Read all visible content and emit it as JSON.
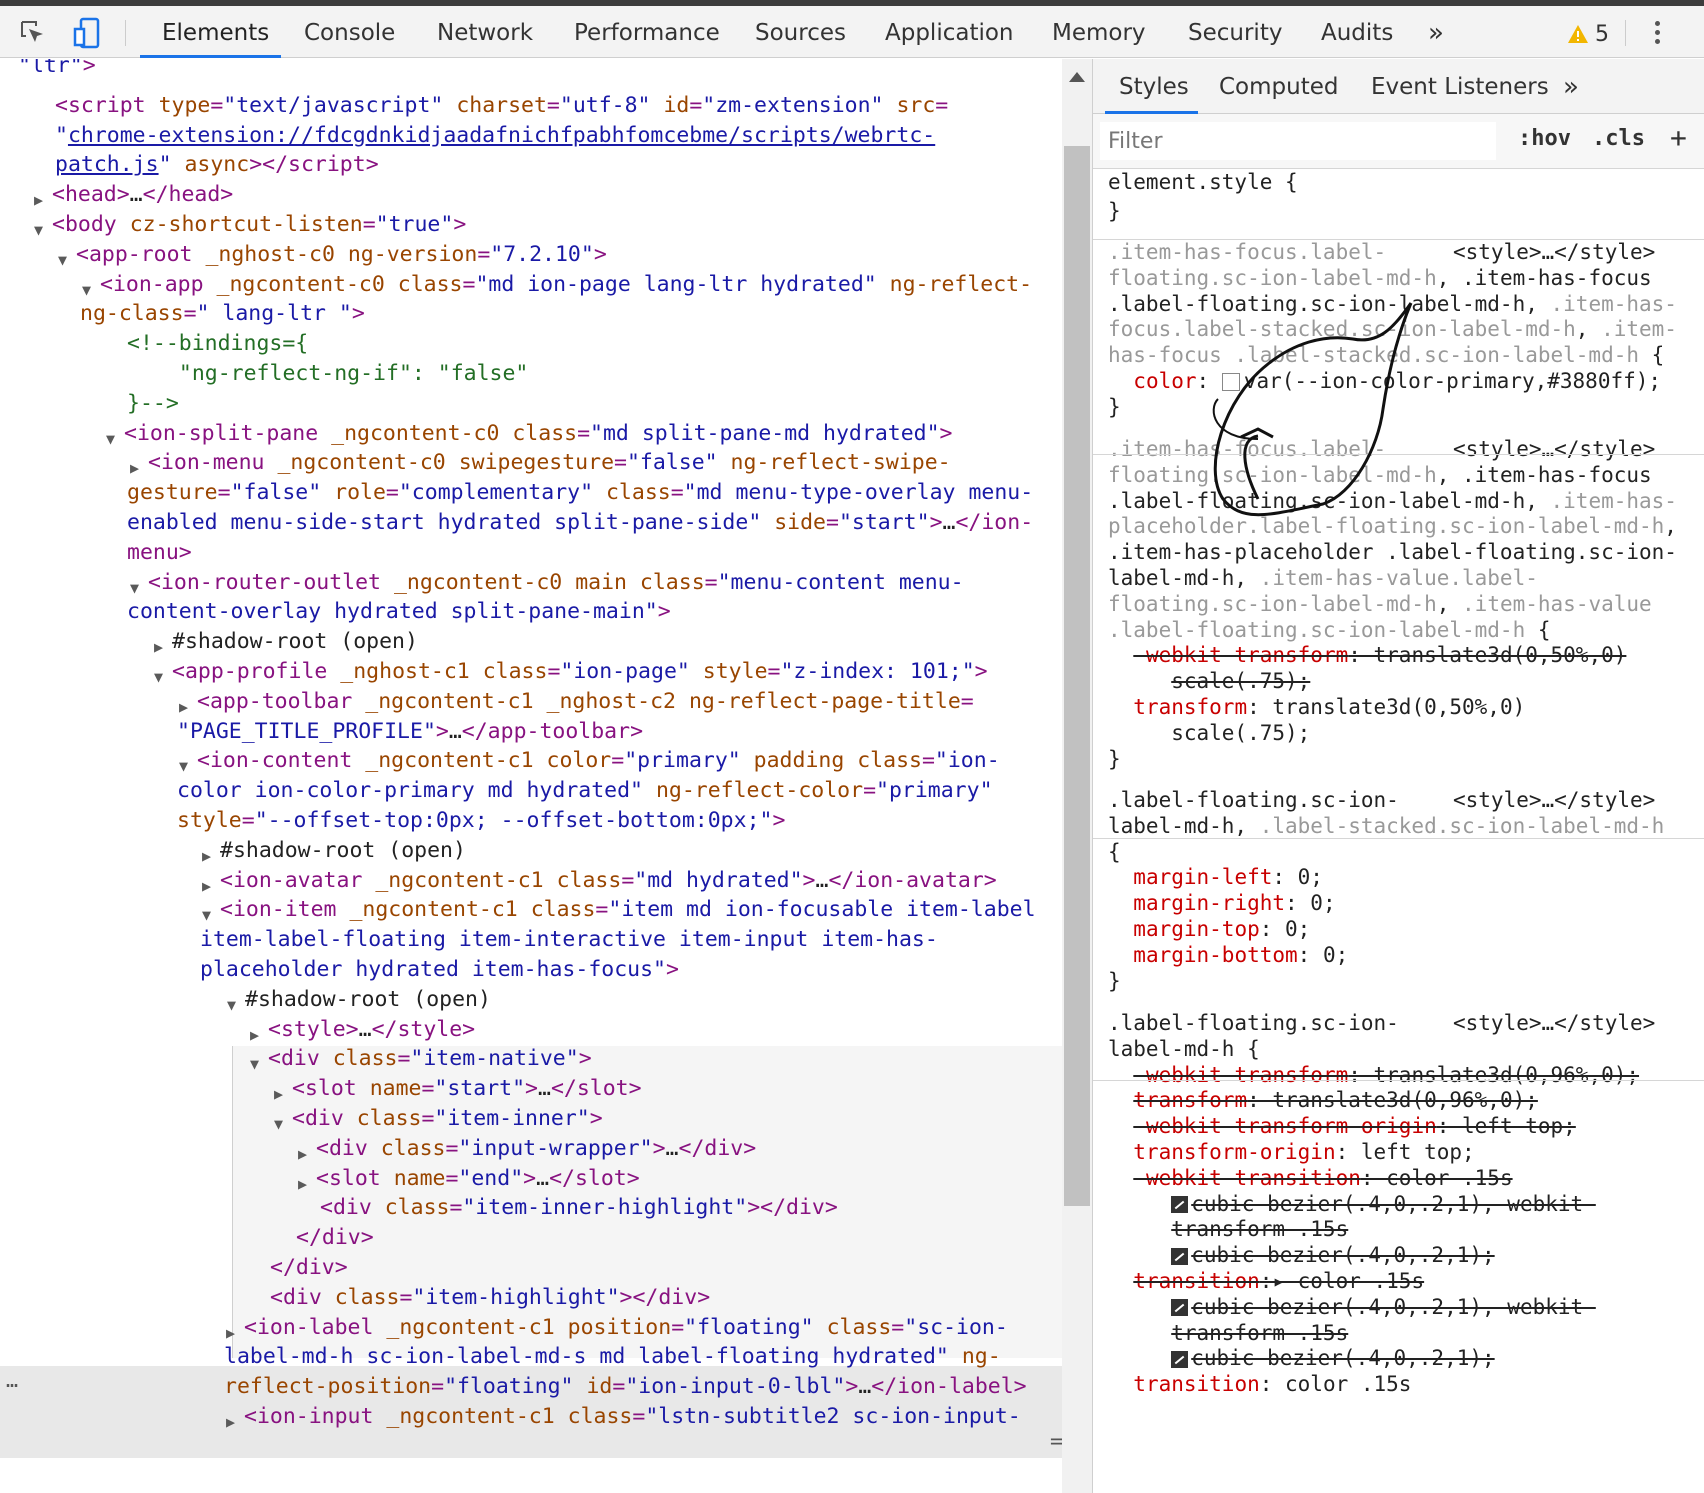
{
  "toolbar": {
    "tabs": [
      "Elements",
      "Console",
      "Network",
      "Performance",
      "Sources",
      "Application",
      "Memory",
      "Security",
      "Audits"
    ],
    "more": "»",
    "warnings_count": "5",
    "icons": [
      "inspect-icon",
      "device-toolbar-icon",
      "warning-icon",
      "kebab-menu-icon"
    ]
  },
  "dom": {
    "lines": [
      {
        "html": "<span class=\"av\">\"ltr\"</span><span class=\"tg\">&gt;</span>"
      },
      {
        "html": "<span class=\"tg\">&lt;script</span> <span class=\"an\">type</span><span class=\"tg\">=</span><span class=\"av\">\"text/javascript\"</span> <span class=\"an\">charset</span><span class=\"tg\">=</span><span class=\"av\">\"utf-8\"</span> <span class=\"an\">id</span><span class=\"tg\">=</span><span class=\"av\">\"zm-extension\"</span> <span class=\"an\">src</span><span class=\"tg\">=</span>"
      },
      {
        "html": "<span class=\"av\">\"</span><span class=\"lk\">chrome-extension://fdcgdnkidjaadafnichfpabhfomcebme/scripts/webrtc-</span>"
      },
      {
        "html": "<span class=\"lk\">patch.js</span><span class=\"av\">\"</span> <span class=\"an\">async</span><span class=\"tg\">&gt;&lt;/script&gt;</span>"
      },
      {
        "html": "<span class=\"tg\">&lt;head&gt;</span>…<span class=\"tg\">&lt;/head&gt;</span>"
      },
      {
        "html": "<span class=\"tg\">&lt;body</span> <span class=\"an\">cz-shortcut-listen</span><span class=\"tg\">=</span><span class=\"av\">\"true\"</span><span class=\"tg\">&gt;</span>"
      },
      {
        "html": "<span class=\"tg\">&lt;app-root</span> <span class=\"an\">_nghost-c0</span> <span class=\"an\">ng-version</span><span class=\"tg\">=</span><span class=\"av\">\"7.2.10\"</span><span class=\"tg\">&gt;</span>"
      },
      {
        "html": "<span class=\"tg\">&lt;ion-app</span> <span class=\"an\">_ngcontent-c0</span> <span class=\"an\">class</span><span class=\"tg\">=</span><span class=\"av\">\"md ion-page lang-ltr hydrated\"</span> <span class=\"an\">ng-reflect-</span>"
      },
      {
        "html": "<span class=\"an\">ng-class</span><span class=\"tg\">=</span><span class=\"av\">\" lang-ltr \"</span><span class=\"tg\">&gt;</span>"
      },
      {
        "html": "<span class=\"cm\">&lt;!--bindings={</span>"
      },
      {
        "html": "<span class=\"cm\">  \"ng-reflect-ng-if\": \"false\"</span>"
      },
      {
        "html": "<span class=\"cm\">}--&gt;</span>"
      },
      {
        "html": "<span class=\"tg\">&lt;ion-split-pane</span> <span class=\"an\">_ngcontent-c0</span> <span class=\"an\">class</span><span class=\"tg\">=</span><span class=\"av\">\"md split-pane-md hydrated\"</span><span class=\"tg\">&gt;</span>"
      },
      {
        "html": "<span class=\"tg\">&lt;ion-menu</span> <span class=\"an\">_ngcontent-c0</span> <span class=\"an\">swipegesture</span><span class=\"tg\">=</span><span class=\"av\">\"false\"</span> <span class=\"an\">ng-reflect-swipe-</span>"
      },
      {
        "html": "<span class=\"an\">gesture</span><span class=\"tg\">=</span><span class=\"av\">\"false\"</span> <span class=\"an\">role</span><span class=\"tg\">=</span><span class=\"av\">\"complementary\"</span> <span class=\"an\">class</span><span class=\"tg\">=</span><span class=\"av\">\"md menu-type-overlay menu-</span>"
      },
      {
        "html": "<span class=\"av\">enabled menu-side-start hydrated split-pane-side\"</span> <span class=\"an\">side</span><span class=\"tg\">=</span><span class=\"av\">\"start\"</span><span class=\"tg\">&gt;</span>…<span class=\"tg\">&lt;/ion-</span>"
      },
      {
        "html": "<span class=\"tg\">menu&gt;</span>"
      },
      {
        "html": "<span class=\"tg\">&lt;ion-router-outlet</span> <span class=\"an\">_ngcontent-c0</span> <span class=\"an\">main</span> <span class=\"an\">class</span><span class=\"tg\">=</span><span class=\"av\">\"menu-content menu-</span>"
      },
      {
        "html": "<span class=\"av\">content-overlay hydrated split-pane-main\"</span><span class=\"tg\">&gt;</span>"
      },
      {
        "html": "#shadow-root (open)"
      },
      {
        "html": "<span class=\"tg\">&lt;app-profile</span> <span class=\"an\">_nghost-c1</span> <span class=\"an\">class</span><span class=\"tg\">=</span><span class=\"av\">\"ion-page\"</span> <span class=\"an\">style</span><span class=\"tg\">=</span><span class=\"av\">\"z-index: 101;\"</span><span class=\"tg\">&gt;</span>"
      },
      {
        "html": "<span class=\"tg\">&lt;app-toolbar</span> <span class=\"an\">_ngcontent-c1</span> <span class=\"an\">_nghost-c2</span> <span class=\"an\">ng-reflect-page-title</span><span class=\"tg\">=</span>"
      },
      {
        "html": "<span class=\"av\">\"PAGE_TITLE_PROFILE\"</span><span class=\"tg\">&gt;</span>…<span class=\"tg\">&lt;/app-toolbar&gt;</span>"
      },
      {
        "html": "<span class=\"tg\">&lt;ion-content</span> <span class=\"an\">_ngcontent-c1</span> <span class=\"an\">color</span><span class=\"tg\">=</span><span class=\"av\">\"primary\"</span> <span class=\"an\">padding</span> <span class=\"an\">class</span><span class=\"tg\">=</span><span class=\"av\">\"ion-</span>"
      },
      {
        "html": "<span class=\"av\">color ion-color-primary md hydrated\"</span> <span class=\"an\">ng-reflect-color</span><span class=\"tg\">=</span><span class=\"av\">\"primary\"</span>"
      },
      {
        "html": "<span class=\"an\">style</span><span class=\"tg\">=</span><span class=\"av\">\"--offset-top:0px; --offset-bottom:0px;\"</span><span class=\"tg\">&gt;</span>"
      },
      {
        "html": "#shadow-root (open)"
      },
      {
        "html": "<span class=\"tg\">&lt;ion-avatar</span> <span class=\"an\">_ngcontent-c1</span> <span class=\"an\">class</span><span class=\"tg\">=</span><span class=\"av\">\"md hydrated\"</span><span class=\"tg\">&gt;</span>…<span class=\"tg\">&lt;/ion-avatar&gt;</span>"
      },
      {
        "html": "<span class=\"tg\">&lt;ion-item</span> <span class=\"an\">_ngcontent-c1</span> <span class=\"an\">class</span><span class=\"tg\">=</span><span class=\"av\">\"item md ion-focusable item-label</span>"
      },
      {
        "html": "<span class=\"av\">item-label-floating item-interactive item-input item-has-</span>"
      },
      {
        "html": "<span class=\"av\">placeholder hydrated item-has-focus\"</span><span class=\"tg\">&gt;</span>"
      },
      {
        "html": "#shadow-root (open)"
      },
      {
        "html": "<span class=\"tg\">&lt;style&gt;</span>…<span class=\"tg\">&lt;/style&gt;</span>"
      },
      {
        "html": "<span class=\"tg\">&lt;div</span> <span class=\"an\">class</span><span class=\"tg\">=</span><span class=\"av\">\"item-native\"</span><span class=\"tg\">&gt;</span>"
      },
      {
        "html": "<span class=\"tg\">&lt;slot</span> <span class=\"an\">name</span><span class=\"tg\">=</span><span class=\"av\">\"start\"</span><span class=\"tg\">&gt;</span>…<span class=\"tg\">&lt;/slot&gt;</span>"
      },
      {
        "html": "<span class=\"tg\">&lt;div</span> <span class=\"an\">class</span><span class=\"tg\">=</span><span class=\"av\">\"item-inner\"</span><span class=\"tg\">&gt;</span>"
      },
      {
        "html": "<span class=\"tg\">&lt;div</span> <span class=\"an\">class</span><span class=\"tg\">=</span><span class=\"av\">\"input-wrapper\"</span><span class=\"tg\">&gt;</span>…<span class=\"tg\">&lt;/div&gt;</span>"
      },
      {
        "html": "<span class=\"tg\">&lt;slot</span> <span class=\"an\">name</span><span class=\"tg\">=</span><span class=\"av\">\"end\"</span><span class=\"tg\">&gt;</span>…<span class=\"tg\">&lt;/slot&gt;</span>"
      },
      {
        "html": "<span class=\"tg\">&lt;div</span> <span class=\"an\">class</span><span class=\"tg\">=</span><span class=\"av\">\"item-inner-highlight\"</span><span class=\"tg\">&gt;&lt;/div&gt;</span>"
      },
      {
        "html": "<span class=\"tg\">&lt;/div&gt;</span>"
      },
      {
        "html": "<span class=\"tg\">&lt;/div&gt;</span>"
      },
      {
        "html": "<span class=\"tg\">&lt;div</span> <span class=\"an\">class</span><span class=\"tg\">=</span><span class=\"av\">\"item-highlight\"</span><span class=\"tg\">&gt;&lt;/div&gt;</span>"
      },
      {
        "html": "<span class=\"tg\">&lt;ion-label</span> <span class=\"an\">_ngcontent-c1</span> <span class=\"an\">position</span><span class=\"tg\">=</span><span class=\"av\">\"floating\"</span> <span class=\"an\">class</span><span class=\"tg\">=</span><span class=\"av\">\"sc-ion-</span>"
      },
      {
        "html": "<span class=\"av\">label-md-h sc-ion-label-md-s md label-floating hydrated\"</span> <span class=\"an\">ng-</span>"
      },
      {
        "html": "<span class=\"an\">reflect-position</span><span class=\"tg\">=</span><span class=\"av\">\"floating\"</span> <span class=\"an\">id</span><span class=\"tg\">=</span><span class=\"av\">\"ion-input-0-lbl\"</span><span class=\"tg\">&gt;</span>…<span class=\"tg\">&lt;/ion-label&gt;</span>"
      },
      {
        "html": "<span class=\"tg\">&lt;ion-input</span> <span class=\"an\">_ngcontent-c1</span> <span class=\"an\">class</span><span class=\"tg\">=</span><span class=\"av\">\"lstn-subtitle2 sc-ion-input-</span>"
      }
    ],
    "selected_marker": "…",
    "eq_marker": "=",
    "triangle_expanded": "▼",
    "triangle_collapsed": "▶"
  },
  "styles_pane": {
    "tabs": [
      "Styles",
      "Computed",
      "Event Listeners"
    ],
    "more": "»",
    "filter_placeholder": "Filter",
    "hov": ":hov",
    "cls": ".cls",
    "plus": "+",
    "src_label": "<style>…</style>",
    "lines": [
      {
        "html": "element.style {"
      },
      {
        "html": "}"
      },
      {
        "html": "<span class=\"dim\">.item-has-focus.label-</span>"
      },
      {
        "html": "<span class=\"dim\">floating.sc-ion-label-md-h</span>, .item-has-focus"
      },
      {
        "html": ".label-floating.sc-ion-label-md-h, <span class=\"dim\">.item-has-</span>"
      },
      {
        "html": "<span class=\"dim\">focus.label-stacked.sc-ion-label-md-h</span>, <span class=\"dim\">.item-</span>"
      },
      {
        "html": "<span class=\"dim\">has-focus .label-stacked.sc-ion-label-md-h</span> {"
      },
      {
        "html": "  <span class=\"pn\">color</span>: <span class=\"swatch\"></span>var(--ion-color-primary,#3880ff);"
      },
      {
        "html": "}"
      },
      {
        "html": "<span class=\"dim\">.item-has-focus.label-</span>"
      },
      {
        "html": "<span class=\"dim\">floating.sc-ion-label-md-h</span>, .item-has-focus"
      },
      {
        "html": ".label-floating.sc-ion-label-md-h, <span class=\"dim\">.item-has-</span>"
      },
      {
        "html": "<span class=\"dim\">placeholder.label-floating.sc-ion-label-md-h</span>,"
      },
      {
        "html": ".item-has-placeholder .label-floating.sc-ion-"
      },
      {
        "html": "label-md-h, <span class=\"dim\">.item-has-value.label-</span>"
      },
      {
        "html": "<span class=\"dim\">floating.sc-ion-label-md-h</span>, <span class=\"dim\">.item-has-value</span>"
      },
      {
        "html": "<span class=\"dim\">.label-floating.sc-ion-label-md-h</span> {"
      },
      {
        "html": "  <span class=\"strike\"><span class=\"pn\">-webkit-transform</span>: translate3d(0,50%,0)</span>"
      },
      {
        "html": "     <span class=\"strike\">scale(.75);</span>"
      },
      {
        "html": "  <span class=\"pn\">transform</span>: translate3d(0,50%,0)"
      },
      {
        "html": "     scale(.75);"
      },
      {
        "html": "}"
      },
      {
        "html": ".label-floating.sc-ion-"
      },
      {
        "html": "label-md-h, <span class=\"dim\">.label-stacked.sc-ion-label-md-h</span>"
      },
      {
        "html": "{"
      },
      {
        "html": "  <span class=\"pn\">margin-left</span>: 0;"
      },
      {
        "html": "  <span class=\"pn\">margin-right</span>: 0;"
      },
      {
        "html": "  <span class=\"pn\">margin-top</span>: 0;"
      },
      {
        "html": "  <span class=\"pn\">margin-bottom</span>: 0;"
      },
      {
        "html": "}"
      },
      {
        "html": ".label-floating.sc-ion-"
      },
      {
        "html": "label-md-h {"
      },
      {
        "html": "  <span class=\"strike\"><span class=\"pn\">-webkit-transform</span>: translate3d(0,96%,0);</span>"
      },
      {
        "html": "  <span class=\"strike\"><span class=\"pn\">transform</span>: translate3d(0,96%,0);</span>"
      },
      {
        "html": "  <span class=\"strike\"><span class=\"pn\">-webkit-transform-origin</span>: left top;</span>"
      },
      {
        "html": "  <span class=\"pn\">transform-origin</span>: left top;"
      },
      {
        "html": "  <span class=\"strike\"><span class=\"pn\">-webkit-transition</span>: color .15s</span>"
      },
      {
        "html": "     <span class=\"bez\"></span><span class=\"strike\">cubic-bezier(.4,0,.2,1), webkit-</span>"
      },
      {
        "html": "     <span class=\"strike\">transform .15s</span>"
      },
      {
        "html": "     <span class=\"bez\"></span><span class=\"strike\">cubic-bezier(.4,0,.2,1);</span>"
      },
      {
        "html": "  <span class=\"strike\"><span class=\"pn\">transition</span>:▸ color .15s</span>"
      },
      {
        "html": "     <span class=\"bez\"></span><span class=\"strike\">cubic-bezier(.4,0,.2,1), webkit-</span>"
      },
      {
        "html": "     <span class=\"strike\">transform .15s</span>"
      },
      {
        "html": "     <span class=\"bez\"></span><span class=\"strike\">cubic-bezier(.4,0,.2,1);</span>"
      },
      {
        "html": "  <span class=\"pn\">transition</span>: color .15s"
      }
    ]
  },
  "colors": {
    "accent": "#1a73e8",
    "tag": "#881280",
    "attr_name": "#994500",
    "attr_value": "#1a1aa6",
    "comment": "#236e25",
    "prop_name": "#c80000",
    "warning": "#f2b600"
  }
}
